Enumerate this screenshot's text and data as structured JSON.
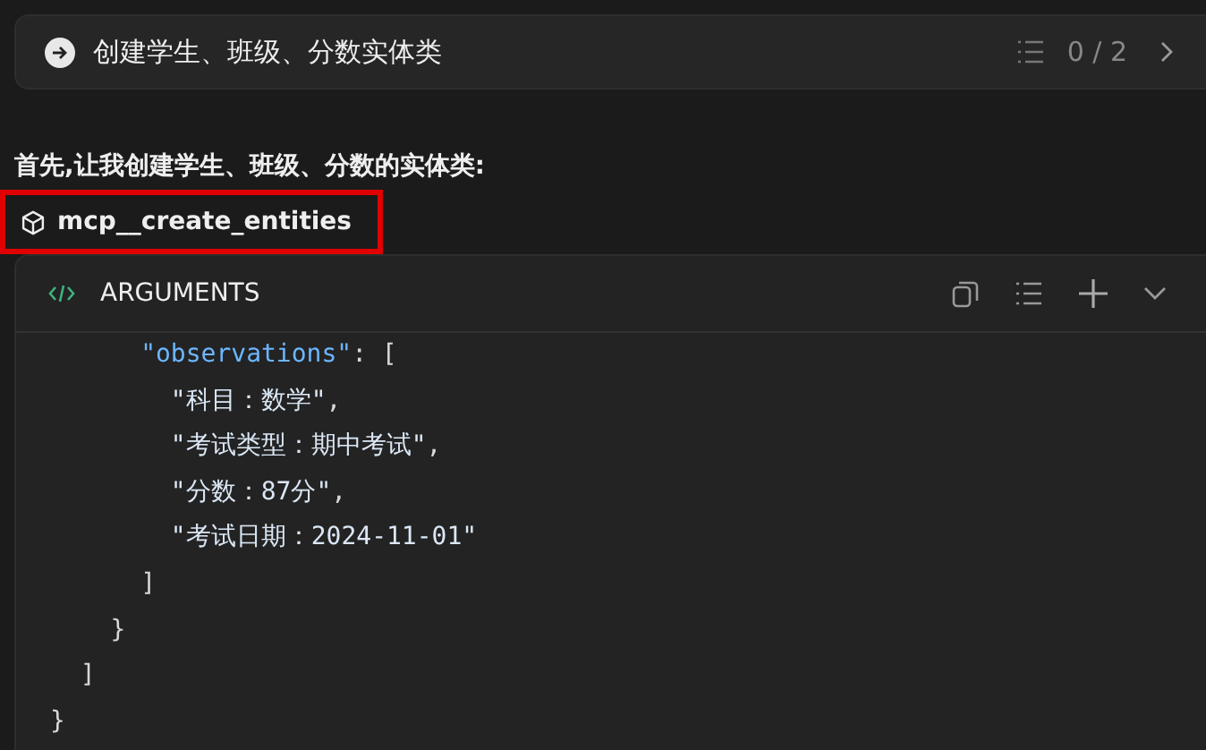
{
  "task": {
    "title": "创建学生、班级、分数实体类",
    "progress": "0 / 2"
  },
  "message": "首先,让我创建学生、班级、分数的实体类:",
  "tool_call": {
    "name": "mcp__create_entities",
    "highlighted": true
  },
  "arguments": {
    "title": "ARGUMENTS",
    "lines": [
      [
        {
          "kind": "key",
          "text": "      \"observations\""
        },
        {
          "kind": "punct",
          "text": ": ["
        }
      ],
      [
        {
          "kind": "string",
          "text": "        \"科目：数学\""
        },
        {
          "kind": "punct",
          "text": ","
        }
      ],
      [
        {
          "kind": "string",
          "text": "        \"考试类型：期中考试\""
        },
        {
          "kind": "punct",
          "text": ","
        }
      ],
      [
        {
          "kind": "string",
          "text": "        \"分数：87分\""
        },
        {
          "kind": "punct",
          "text": ","
        }
      ],
      [
        {
          "kind": "string",
          "text": "        \"考试日期：2024-11-01\""
        }
      ],
      [
        {
          "kind": "punct",
          "text": "      ]"
        }
      ],
      [
        {
          "kind": "punct",
          "text": "    }"
        }
      ],
      [
        {
          "kind": "punct",
          "text": "  ]"
        }
      ],
      [
        {
          "kind": "punct",
          "text": "}"
        }
      ]
    ]
  }
}
